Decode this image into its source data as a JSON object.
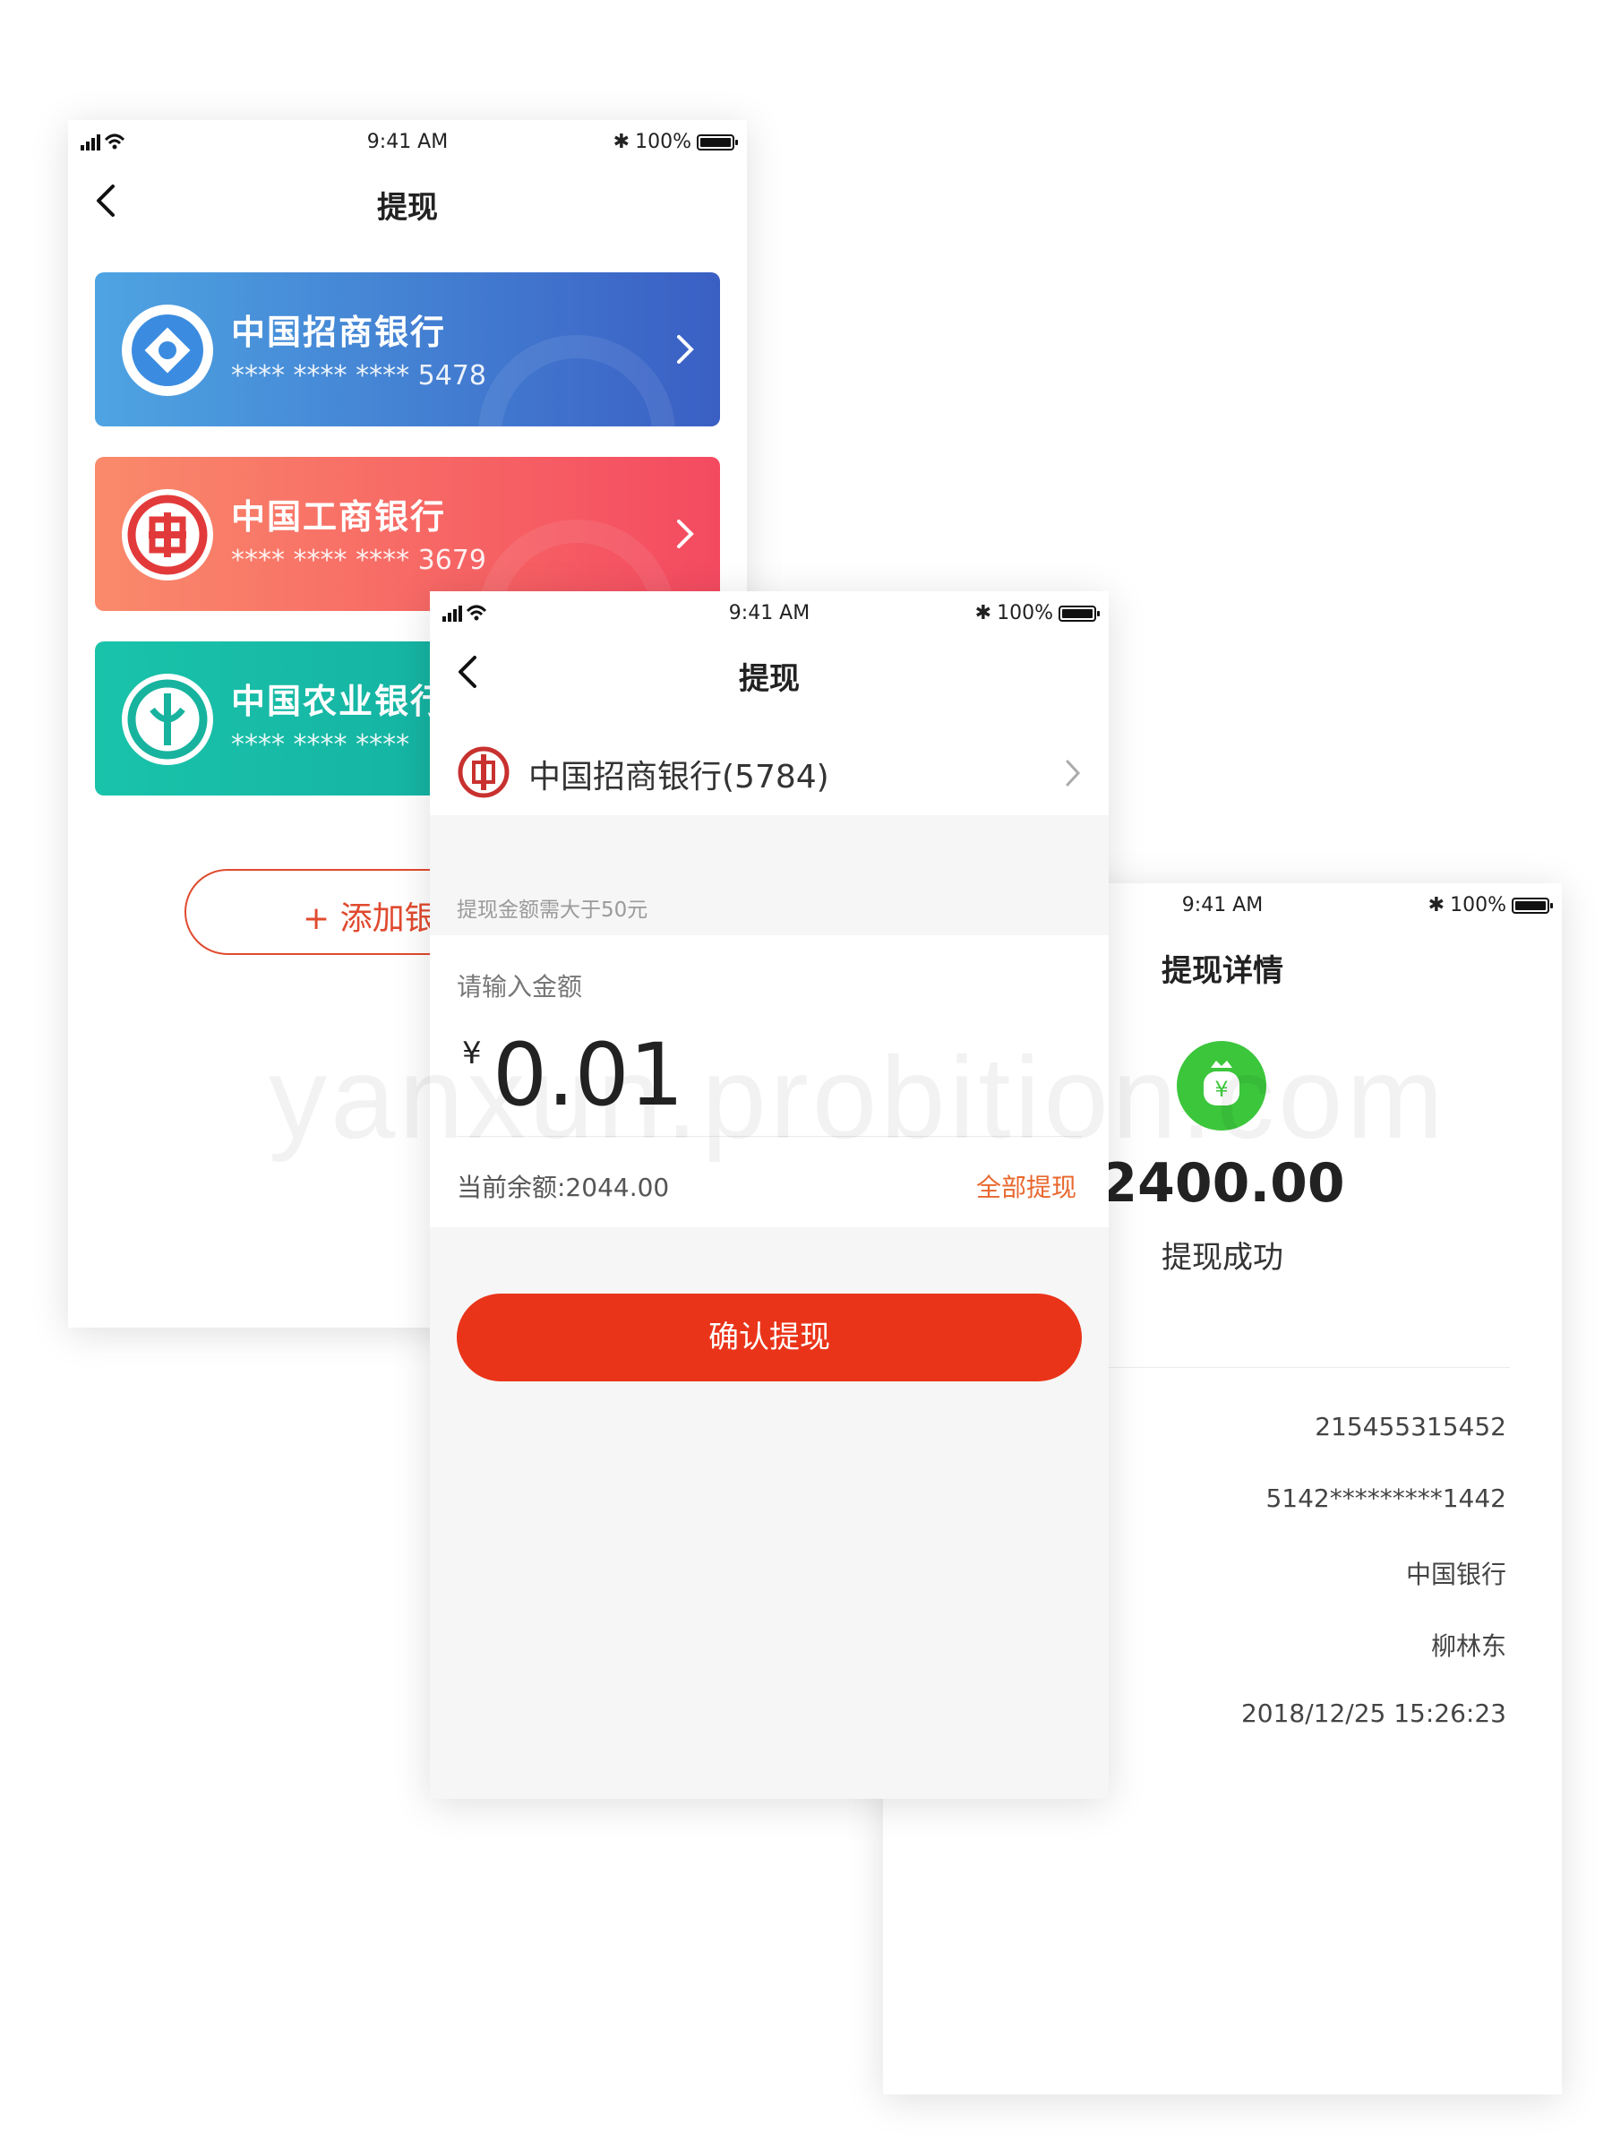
{
  "status_bar": {
    "time": "9:41 AM",
    "battery": "100%"
  },
  "bank_list_screen": {
    "title": "提现",
    "cards": [
      {
        "name": "中国招商银行",
        "number": "**** **** **** 5478",
        "gradient": [
          "#4a9fe0",
          "#3d63c6"
        ]
      },
      {
        "name": "中国工商银行",
        "number": "**** **** **** 3679",
        "gradient": [
          "#f9866d",
          "#f34a5e"
        ]
      },
      {
        "name": "中国农业银行",
        "number": "**** **** ****",
        "gradient": [
          "#16c1a8",
          "#15a79e"
        ]
      }
    ],
    "add_button": "+ 添加银"
  },
  "withdraw_screen": {
    "title": "提现",
    "selected_bank": "中国招商银行(5784)",
    "hint": "提现金额需大于50元",
    "input_label": "请输入金额",
    "currency_symbol": "¥",
    "amount_value": "0.01",
    "balance": "当前余额:2044.00",
    "withdraw_all": "全部提现",
    "confirm_button": "确认提现",
    "accent_color": "#ea3419"
  },
  "detail_screen": {
    "title": "提现详情",
    "amount": "2400.00",
    "status": "提现成功",
    "details": [
      "215455315452",
      "5142*********1442",
      "中国银行",
      "柳林东",
      "2018/12/25 15:26:23"
    ],
    "success_color": "#3cc63c"
  },
  "watermark": "yanxun.probition.com"
}
